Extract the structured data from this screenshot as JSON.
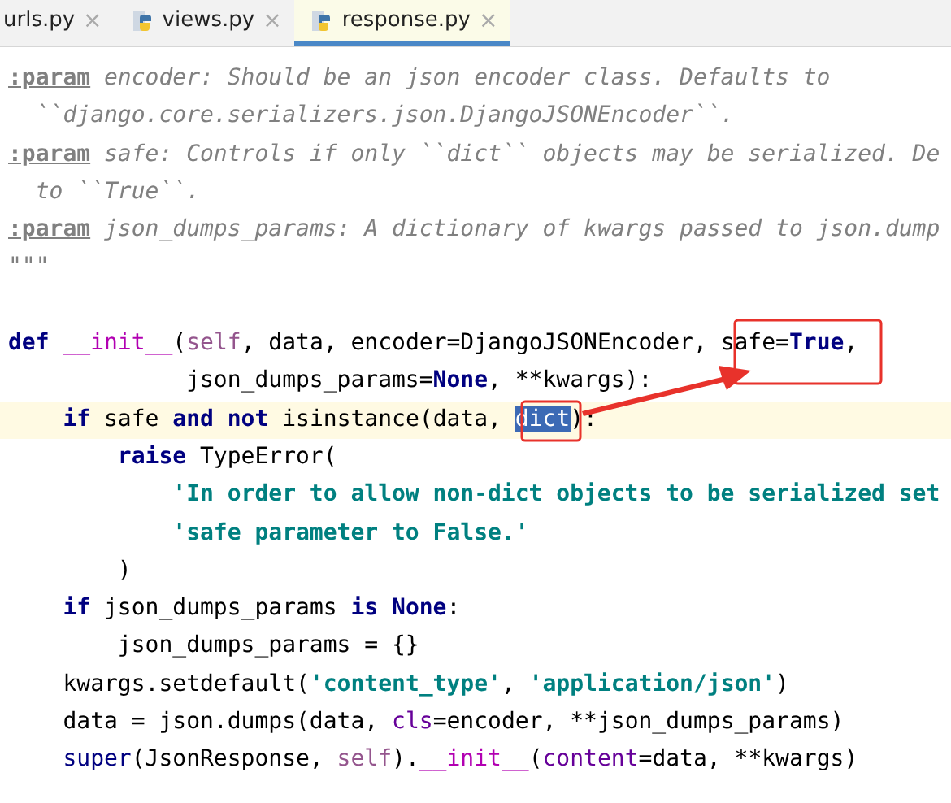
{
  "tabs": [
    {
      "label": "urls.py",
      "selected": false,
      "icon": false
    },
    {
      "label": "views.py",
      "selected": false,
      "icon": true
    },
    {
      "label": "response.py",
      "selected": true,
      "icon": true
    }
  ],
  "close_glyph": "×",
  "lines": [
    {
      "current": false,
      "segments": [
        {
          "text": ":param",
          "kind": "param"
        },
        {
          "text": " encoder: Should be an json encoder class. Defaults to",
          "kind": "doc"
        }
      ]
    },
    {
      "current": false,
      "segments": [
        {
          "text": "  ``django.core.serializers.json.DjangoJSONEncoder``.",
          "kind": "doc"
        }
      ]
    },
    {
      "current": false,
      "segments": [
        {
          "text": ":param",
          "kind": "param"
        },
        {
          "text": " safe: Controls if only ``dict`` objects may be serialized. De",
          "kind": "doc"
        }
      ]
    },
    {
      "current": false,
      "segments": [
        {
          "text": "  to ``True``.",
          "kind": "doc"
        }
      ]
    },
    {
      "current": false,
      "segments": [
        {
          "text": ":param",
          "kind": "param"
        },
        {
          "text": " json_dumps_params: A dictionary of kwargs passed to json.dump",
          "kind": "doc"
        }
      ]
    },
    {
      "current": false,
      "segments": [
        {
          "text": "\"\"\"",
          "kind": "doc"
        }
      ]
    },
    {
      "current": false
    },
    {
      "current": false,
      "segments": [
        {
          "text": "def ",
          "kind": "keyword"
        },
        {
          "text": "__init__",
          "kind": "magic"
        },
        {
          "text": "(",
          "kind": "plain"
        },
        {
          "text": "self",
          "kind": "self"
        },
        {
          "text": ", data, encoder=DjangoJSONEncoder, safe=",
          "kind": "plain"
        },
        {
          "text": "True",
          "kind": "keyword"
        },
        {
          "text": ",",
          "kind": "plain"
        }
      ]
    },
    {
      "current": false,
      "segments": [
        {
          "text": "             json_dumps_params=",
          "kind": "plain"
        },
        {
          "text": "None",
          "kind": "keyword"
        },
        {
          "text": ", **kwargs):",
          "kind": "plain"
        }
      ]
    },
    {
      "current": true,
      "segments": [
        {
          "text": "    if",
          "kind": "keyword"
        },
        {
          "text": " safe ",
          "kind": "plain"
        },
        {
          "text": "and not",
          "kind": "keyword"
        },
        {
          "text": " isinstance(data, ",
          "kind": "plain"
        },
        {
          "text": "dict",
          "kind": "selected"
        },
        {
          "text": "):",
          "kind": "plain"
        }
      ]
    },
    {
      "current": false,
      "segments": [
        {
          "text": "        raise",
          "kind": "keyword"
        },
        {
          "text": " TypeError(",
          "kind": "plain"
        }
      ]
    },
    {
      "current": false,
      "segments": [
        {
          "text": "            'In order to allow non-dict objects to be serialized set",
          "kind": "string"
        }
      ]
    },
    {
      "current": false,
      "segments": [
        {
          "text": "            'safe parameter to False.'",
          "kind": "string"
        }
      ]
    },
    {
      "current": false,
      "segments": [
        {
          "text": "        )",
          "kind": "plain"
        }
      ]
    },
    {
      "current": false,
      "segments": [
        {
          "text": "    if",
          "kind": "keyword"
        },
        {
          "text": " json_dumps_params ",
          "kind": "plain"
        },
        {
          "text": "is None",
          "kind": "keyword"
        },
        {
          "text": ":",
          "kind": "plain"
        }
      ]
    },
    {
      "current": false,
      "segments": [
        {
          "text": "        json_dumps_params = {}",
          "kind": "plain"
        }
      ]
    },
    {
      "current": false,
      "segments": [
        {
          "text": "    kwargs.setdefault(",
          "kind": "plain"
        },
        {
          "text": "'content_type'",
          "kind": "string"
        },
        {
          "text": ", ",
          "kind": "plain"
        },
        {
          "text": "'application/json'",
          "kind": "string"
        },
        {
          "text": ")",
          "kind": "plain"
        }
      ]
    },
    {
      "current": false,
      "segments": [
        {
          "text": "    data = json.dumps(data, ",
          "kind": "plain"
        },
        {
          "text": "cls",
          "kind": "named"
        },
        {
          "text": "=encoder, **json_dumps_params)",
          "kind": "plain"
        }
      ]
    },
    {
      "current": false,
      "segments": [
        {
          "text": "    super",
          "kind": "builtin"
        },
        {
          "text": "(JsonResponse, ",
          "kind": "plain"
        },
        {
          "text": "self",
          "kind": "self"
        },
        {
          "text": ").",
          "kind": "plain"
        },
        {
          "text": "__init__",
          "kind": "magic"
        },
        {
          "text": "(",
          "kind": "plain"
        },
        {
          "text": "content",
          "kind": "named"
        },
        {
          "text": "=data, **kwargs)",
          "kind": "plain"
        }
      ]
    }
  ]
}
